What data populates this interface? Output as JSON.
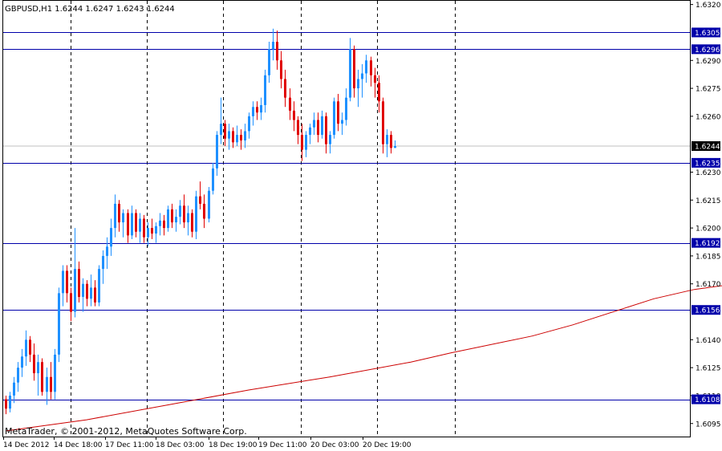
{
  "title": "GBPUSD,H1  1.6244 1.6247 1.6243 1.6244",
  "credit": "MetaTrader, © 2001-2012, MetaQuotes Software Corp.",
  "colors": {
    "background": "#ffffff",
    "frame": "#000000",
    "bull": "#1e90ff",
    "bear": "#e00000",
    "grid": "#000000",
    "level": "#0000aa",
    "level_tag": "#0000aa",
    "current_tag": "#000000",
    "bid_line": "#c0c0c0",
    "ma_line": "#cc0000"
  },
  "chart_data": {
    "type": "candlestick",
    "symbol": "GBPUSD",
    "timeframe": "H1",
    "ylim": [
      1.6088,
      1.6322
    ],
    "y_ticks": [
      "1.6320",
      "1.6290",
      "1.6275",
      "1.6260",
      "1.6230",
      "1.6215",
      "1.6200",
      "1.6185",
      "1.6170",
      "1.6140",
      "1.6125",
      "1.6110",
      "1.6095"
    ],
    "x_ticks": [
      "14 Dec 2012",
      "14 Dec 18:00",
      "17 Dec 11:00",
      "18 Dec 03:00",
      "18 Dec 19:00",
      "19 Dec 11:00",
      "20 Dec 03:00",
      "20 Dec 19:00"
    ],
    "current_price": "1.6244",
    "levels": [
      "1.6305",
      "1.6296",
      "1.6235",
      "1.6192",
      "1.6156",
      "1.6108"
    ],
    "moving_average": [
      [
        0,
        1.6091
      ],
      [
        20,
        1.6097
      ],
      [
        40,
        1.6105
      ],
      [
        60,
        1.6113
      ],
      [
        80,
        1.612
      ],
      [
        100,
        1.6128
      ],
      [
        110,
        1.6133
      ],
      [
        130,
        1.6142
      ],
      [
        140,
        1.6148
      ],
      [
        160,
        1.6162
      ],
      [
        170,
        1.6167
      ],
      [
        190,
        1.6173
      ],
      [
        210,
        1.618
      ],
      [
        230,
        1.6187
      ],
      [
        245,
        1.619
      ]
    ],
    "candles": [
      [
        1.6108,
        1.611,
        1.61,
        1.6103
      ],
      [
        1.6103,
        1.6112,
        1.6101,
        1.611
      ],
      [
        1.611,
        1.612,
        1.6106,
        1.6117
      ],
      [
        1.6117,
        1.6128,
        1.6112,
        1.6125
      ],
      [
        1.6125,
        1.6135,
        1.612,
        1.6131
      ],
      [
        1.6131,
        1.6145,
        1.6126,
        1.614
      ],
      [
        1.614,
        1.6142,
        1.6128,
        1.6132
      ],
      [
        1.6132,
        1.6138,
        1.6118,
        1.6122
      ],
      [
        1.6122,
        1.6132,
        1.611,
        1.6128
      ],
      [
        1.6128,
        1.613,
        1.611,
        1.6112
      ],
      [
        1.6112,
        1.6125,
        1.6105,
        1.612
      ],
      [
        1.612,
        1.6128,
        1.6108,
        1.6112
      ],
      [
        1.6112,
        1.6135,
        1.6108,
        1.6132
      ],
      [
        1.6132,
        1.6168,
        1.6128,
        1.6165
      ],
      [
        1.6165,
        1.618,
        1.6158,
        1.6177
      ],
      [
        1.6177,
        1.618,
        1.616,
        1.6165
      ],
      [
        1.6165,
        1.6168,
        1.615,
        1.6155
      ],
      [
        1.6155,
        1.62,
        1.6152,
        1.6178
      ],
      [
        1.6178,
        1.6182,
        1.616,
        1.6163
      ],
      [
        1.6163,
        1.6173,
        1.6155,
        1.617
      ],
      [
        1.617,
        1.6172,
        1.6158,
        1.6162
      ],
      [
        1.6162,
        1.6175,
        1.6158,
        1.6168
      ],
      [
        1.6168,
        1.6172,
        1.6158,
        1.616
      ],
      [
        1.616,
        1.618,
        1.6158,
        1.6178
      ],
      [
        1.6178,
        1.6188,
        1.617,
        1.6185
      ],
      [
        1.6185,
        1.6195,
        1.6178,
        1.619
      ],
      [
        1.619,
        1.6205,
        1.6185,
        1.62
      ],
      [
        1.62,
        1.6218,
        1.6195,
        1.6213
      ],
      [
        1.6213,
        1.6215,
        1.6198,
        1.6203
      ],
      [
        1.6203,
        1.621,
        1.6195,
        1.6208
      ],
      [
        1.6208,
        1.621,
        1.6192,
        1.6196
      ],
      [
        1.6196,
        1.6212,
        1.6194,
        1.6208
      ],
      [
        1.6208,
        1.621,
        1.6195,
        1.6198
      ],
      [
        1.6198,
        1.6208,
        1.6192,
        1.6205
      ],
      [
        1.6205,
        1.6207,
        1.6192,
        1.6195
      ],
      [
        1.6195,
        1.6203,
        1.619,
        1.62
      ],
      [
        1.62,
        1.6205,
        1.6194,
        1.6197
      ],
      [
        1.6197,
        1.6203,
        1.6192,
        1.6201
      ],
      [
        1.6201,
        1.6208,
        1.6196,
        1.6204
      ],
      [
        1.6204,
        1.6207,
        1.6196,
        1.62
      ],
      [
        1.62,
        1.6212,
        1.6198,
        1.621
      ],
      [
        1.621,
        1.6213,
        1.62,
        1.6203
      ],
      [
        1.6203,
        1.621,
        1.6198,
        1.6206
      ],
      [
        1.6206,
        1.6215,
        1.6202,
        1.6212
      ],
      [
        1.6212,
        1.6218,
        1.62,
        1.6203
      ],
      [
        1.6203,
        1.6212,
        1.6196,
        1.6208
      ],
      [
        1.6208,
        1.621,
        1.6195,
        1.6198
      ],
      [
        1.6198,
        1.622,
        1.6194,
        1.6217
      ],
      [
        1.6217,
        1.6225,
        1.621,
        1.6213
      ],
      [
        1.6213,
        1.6218,
        1.62,
        1.6205
      ],
      [
        1.6205,
        1.6222,
        1.6203,
        1.622
      ],
      [
        1.622,
        1.6235,
        1.6218,
        1.6232
      ],
      [
        1.6232,
        1.6252,
        1.6228,
        1.625
      ],
      [
        1.625,
        1.627,
        1.6245,
        1.6256
      ],
      [
        1.6256,
        1.6258,
        1.6244,
        1.6248
      ],
      [
        1.6248,
        1.6256,
        1.6242,
        1.6252
      ],
      [
        1.6252,
        1.6254,
        1.6243,
        1.6246
      ],
      [
        1.6246,
        1.6255,
        1.6244,
        1.625
      ],
      [
        1.625,
        1.6253,
        1.6242,
        1.6247
      ],
      [
        1.6247,
        1.6256,
        1.6243,
        1.6252
      ],
      [
        1.6252,
        1.6262,
        1.6248,
        1.626
      ],
      [
        1.626,
        1.6268,
        1.6255,
        1.6265
      ],
      [
        1.6265,
        1.6268,
        1.6258,
        1.6262
      ],
      [
        1.6262,
        1.627,
        1.6258,
        1.6266
      ],
      [
        1.6266,
        1.6285,
        1.6262,
        1.6282
      ],
      [
        1.6282,
        1.63,
        1.6278,
        1.6296
      ],
      [
        1.6296,
        1.6307,
        1.629,
        1.63
      ],
      [
        1.63,
        1.6306,
        1.6285,
        1.629
      ],
      [
        1.629,
        1.6295,
        1.6275,
        1.628
      ],
      [
        1.628,
        1.6285,
        1.6265,
        1.627
      ],
      [
        1.627,
        1.6275,
        1.6258,
        1.6263
      ],
      [
        1.6263,
        1.6268,
        1.6252,
        1.6258
      ],
      [
        1.6258,
        1.626,
        1.6245,
        1.625
      ],
      [
        1.625,
        1.6256,
        1.6236,
        1.6242
      ],
      [
        1.6242,
        1.6252,
        1.6238,
        1.625
      ],
      [
        1.625,
        1.6256,
        1.6245,
        1.6254
      ],
      [
        1.6254,
        1.6262,
        1.625,
        1.6258
      ],
      [
        1.6258,
        1.6262,
        1.6246,
        1.625
      ],
      [
        1.625,
        1.6263,
        1.6248,
        1.626
      ],
      [
        1.626,
        1.6262,
        1.624,
        1.6245
      ],
      [
        1.6245,
        1.6252,
        1.624,
        1.625
      ],
      [
        1.625,
        1.627,
        1.6248,
        1.6268
      ],
      [
        1.6268,
        1.6272,
        1.6252,
        1.6256
      ],
      [
        1.6256,
        1.6262,
        1.625,
        1.6258
      ],
      [
        1.6258,
        1.6275,
        1.6255,
        1.627
      ],
      [
        1.627,
        1.6302,
        1.6268,
        1.6296
      ],
      [
        1.6296,
        1.6298,
        1.627,
        1.6275
      ],
      [
        1.6275,
        1.6285,
        1.6265,
        1.628
      ],
      [
        1.628,
        1.6288,
        1.627,
        1.6283
      ],
      [
        1.6283,
        1.6293,
        1.6278,
        1.629
      ],
      [
        1.629,
        1.6292,
        1.6276,
        1.6282
      ],
      [
        1.6282,
        1.6286,
        1.627,
        1.6278
      ],
      [
        1.6278,
        1.6282,
        1.6262,
        1.6268
      ],
      [
        1.6268,
        1.627,
        1.624,
        1.6245
      ],
      [
        1.6245,
        1.6253,
        1.6238,
        1.625
      ],
      [
        1.625,
        1.6252,
        1.624,
        1.6243
      ],
      [
        1.6243,
        1.6247,
        1.6243,
        1.6244
      ]
    ]
  }
}
